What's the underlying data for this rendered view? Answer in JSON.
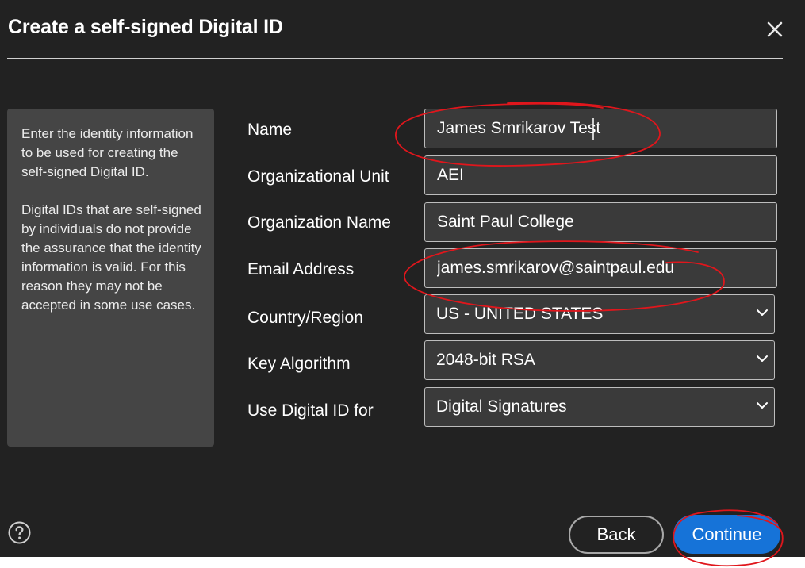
{
  "dialog": {
    "title": "Create a self-signed Digital ID",
    "close_icon": "close-icon"
  },
  "info": {
    "paragraph1": "Enter the identity information to be used for creating the self-signed Digital ID.",
    "paragraph2": "Digital IDs that are self-signed by individuals do not provide the assurance that the identity information is valid. For this reason they may not be accepted in some use cases."
  },
  "form": {
    "name_label": "Name",
    "name_value": "James Smrikarov Test",
    "org_unit_label": "Organizational Unit",
    "org_unit_value": "AEI",
    "org_name_label": "Organization Name",
    "org_name_value": "Saint Paul College",
    "email_label": "Email Address",
    "email_value": "james.smrikarov@saintpaul.edu",
    "country_label": "Country/Region",
    "country_value": "US - UNITED STATES",
    "key_algorithm_label": "Key Algorithm",
    "key_algorithm_value": "2048-bit RSA",
    "use_for_label": "Use Digital ID for",
    "use_for_value": "Digital Signatures"
  },
  "footer": {
    "help_icon": "help-icon",
    "back_label": "Back",
    "continue_label": "Continue"
  },
  "colors": {
    "background": "#222222",
    "panel": "#454545",
    "field": "#3a3a3a",
    "primary_button": "#1673d8",
    "annotation": "#e0161c"
  }
}
